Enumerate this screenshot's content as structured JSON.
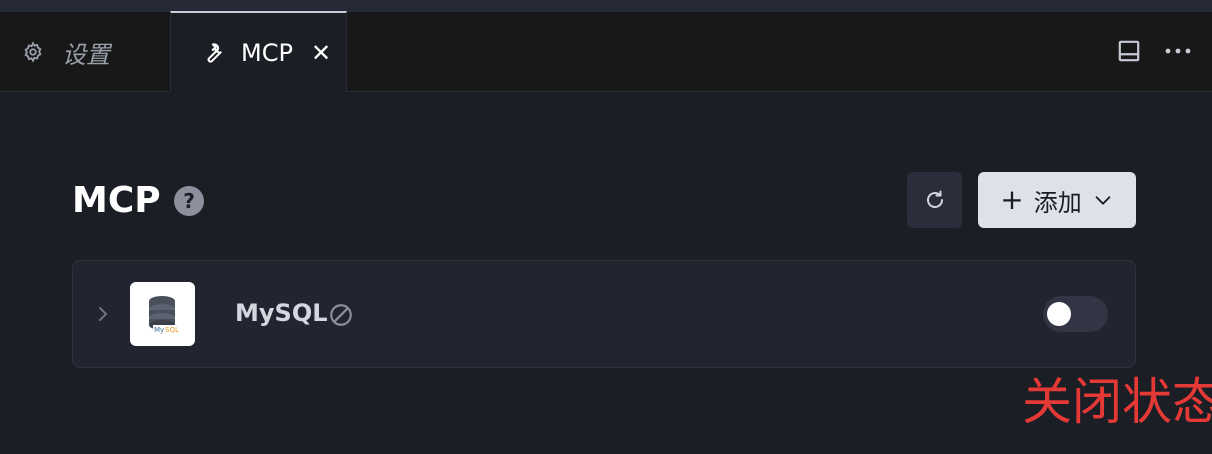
{
  "tabs": [
    {
      "label": "设置",
      "icon": "gear-icon",
      "active": false
    },
    {
      "label": "MCP",
      "icon": "wrench-icon",
      "active": true,
      "close": "✕"
    }
  ],
  "tab_actions": [
    {
      "icon": "panel-layout-icon"
    },
    {
      "icon": "more-icon"
    }
  ],
  "header": {
    "title": "MCP",
    "help": "?",
    "refresh_icon": "refresh-icon",
    "add_label": "添加",
    "add_plus": "+"
  },
  "server": {
    "name": "MySQL",
    "logo": "mysql-database-logo",
    "status_icon": "disabled-icon",
    "enabled": false
  },
  "annotation": "关闭状态",
  "colors": {
    "background": "#1c1e26",
    "tabbar": "#181818",
    "card": "#222530",
    "annotation": "#e53935"
  }
}
